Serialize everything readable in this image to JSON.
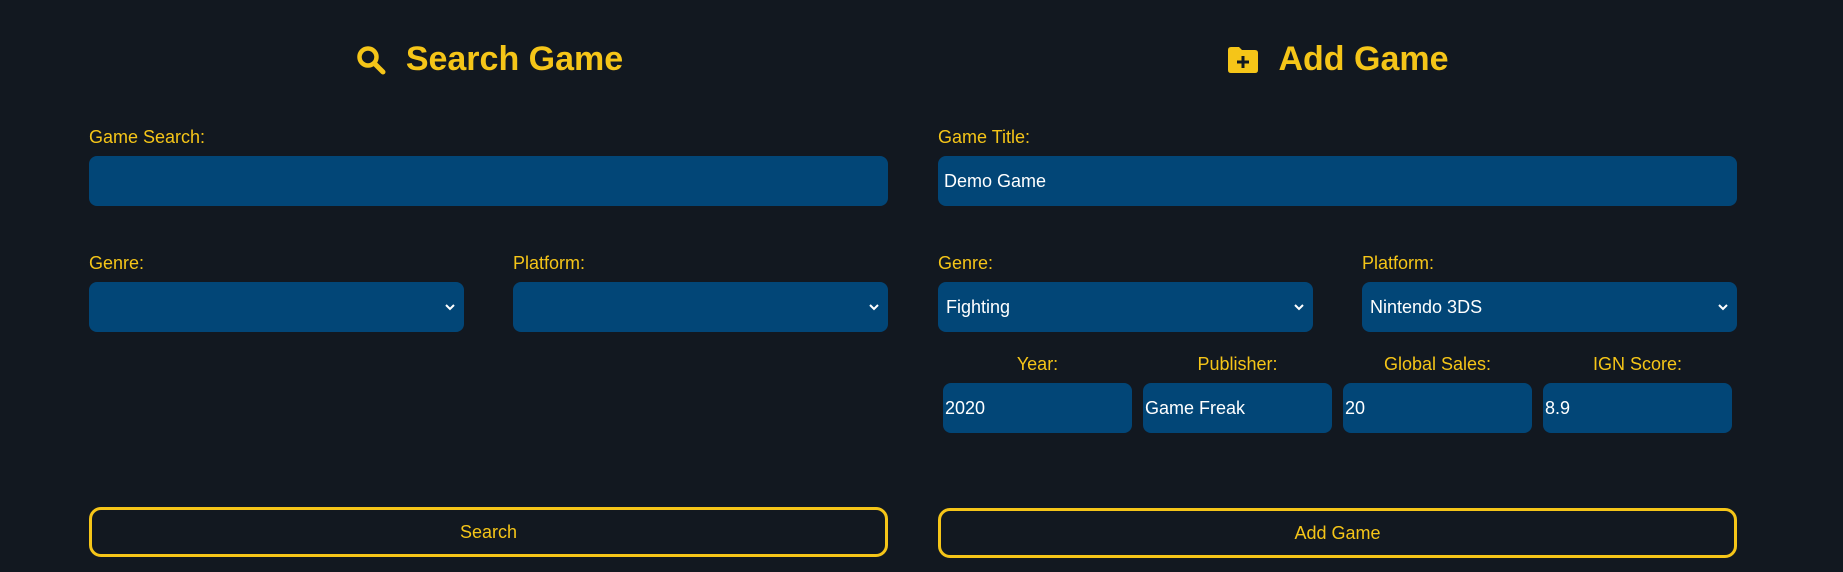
{
  "search_panel": {
    "title": "Search Game",
    "title_icon": "search-icon",
    "game_search_label": "Game Search:",
    "game_search_value": "",
    "genre_label": "Genre:",
    "genre_value": "",
    "platform_label": "Platform:",
    "platform_value": "",
    "search_button_label": "Search"
  },
  "add_panel": {
    "title": "Add Game",
    "title_icon": "folder-plus-icon",
    "game_title_label": "Game Title:",
    "game_title_value": "Demo Game",
    "genre_label": "Genre:",
    "genre_value": "Fighting",
    "platform_label": "Platform:",
    "platform_value": "Nintendo 3DS",
    "year_label": "Year:",
    "year_value": "2020",
    "publisher_label": "Publisher:",
    "publisher_value": "Game Freak",
    "global_sales_label": "Global Sales:",
    "global_sales_value": "20",
    "ign_score_label": "IGN Score:",
    "ign_score_value": "8.9",
    "add_button_label": "Add Game"
  },
  "colors": {
    "background": "#121820",
    "accent": "#f5c518",
    "input_background": "#024677",
    "input_text": "#ffffff"
  }
}
